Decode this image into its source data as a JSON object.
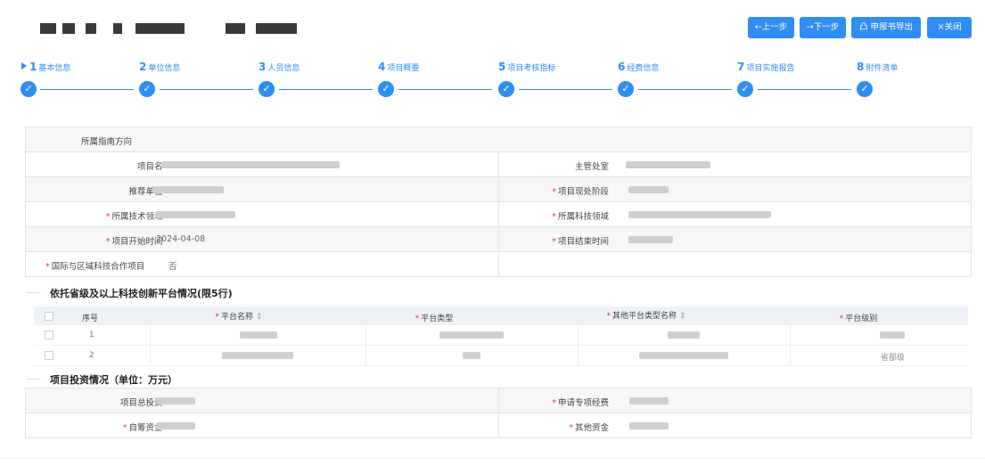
{
  "toolbar": {
    "prev_label": "←上一步",
    "next_label": "→下一步",
    "export_label": "凸 申报书导出",
    "close_label": "×关闭"
  },
  "steps": [
    {
      "num": "1",
      "label": "基本信息"
    },
    {
      "num": "2",
      "label": "单位信息"
    },
    {
      "num": "3",
      "label": "人员信息"
    },
    {
      "num": "4",
      "label": "项目概要"
    },
    {
      "num": "5",
      "label": "项目考核指标"
    },
    {
      "num": "6",
      "label": "经费信息"
    },
    {
      "num": "7",
      "label": "项目实施报告"
    },
    {
      "num": "8",
      "label": "附件清单"
    }
  ],
  "step_check": "✓",
  "basic": {
    "guide_direction": "所属指南方向",
    "project_name": "项目名",
    "supervisor": "主管处室",
    "recommend_unit": "推荐单位",
    "stage": "项目现处阶段",
    "tech_field": "所属技术领域",
    "sci_field": "所属科技领域",
    "start_time": "项目开始时间",
    "start_time_value": "2024-04-08",
    "end_time": "项目结束时间",
    "intl_coop": "国际与区域科技合作项目",
    "intl_coop_value": "否"
  },
  "platform": {
    "title": "依托省级及以上科技创新平台情况(限5行)",
    "columns": {
      "seq": "序号",
      "name": "平台名称",
      "type": "平台类型",
      "other_type": "其他平台类型名称",
      "level": "平台级别"
    },
    "sort_icon": "⇕",
    "rows": [
      {
        "seq": "1",
        "level": ""
      },
      {
        "seq": "2",
        "level": "省部级"
      }
    ]
  },
  "investment": {
    "title": "项目投资情况（单位：万元）",
    "total": "项目总投资",
    "special_funds": "申请专项经费",
    "self_funds": "自筹资金",
    "other_funds": "其他资金"
  },
  "required_mark": "*"
}
